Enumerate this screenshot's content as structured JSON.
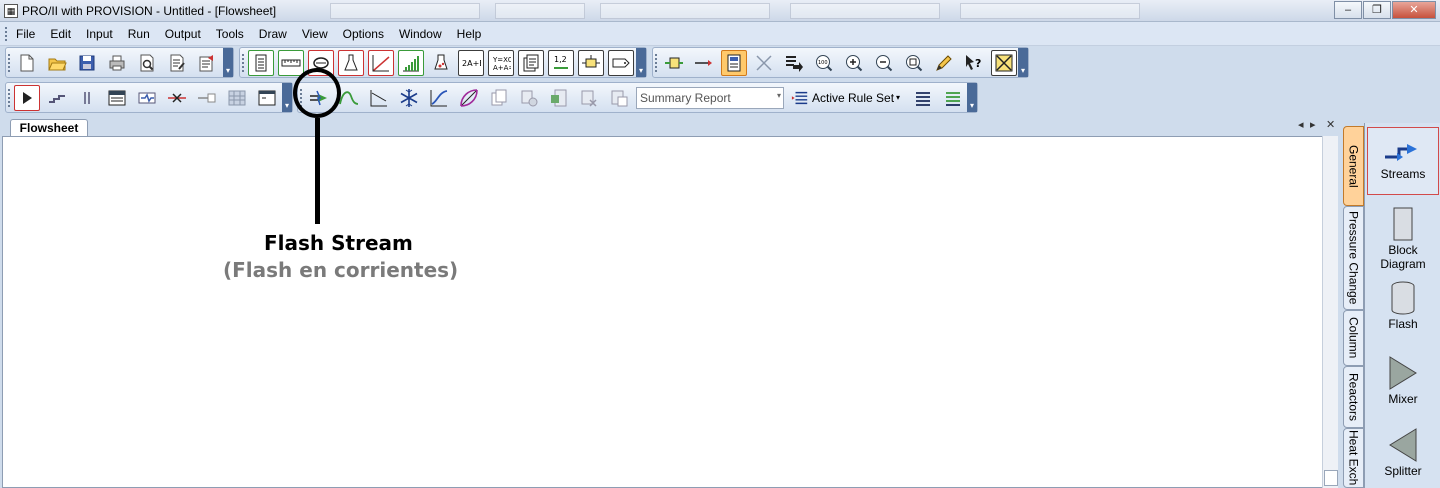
{
  "window": {
    "title": "PRO/II with PROVISION - Untitled - [Flowsheet]",
    "app_icon": "proii-app-icon",
    "controls": {
      "minimize": "–",
      "restore": "❐",
      "close": "✕"
    }
  },
  "menubar": {
    "items": [
      {
        "label": "File"
      },
      {
        "label": "Edit"
      },
      {
        "label": "Input"
      },
      {
        "label": "Run"
      },
      {
        "label": "Output"
      },
      {
        "label": "Tools"
      },
      {
        "label": "Draw"
      },
      {
        "label": "View"
      },
      {
        "label": "Options"
      },
      {
        "label": "Window"
      },
      {
        "label": "Help"
      }
    ]
  },
  "toolbar": {
    "summary_report": "Summary Report",
    "active_rule_set": "Active Rule Set",
    "dropdown_arrow": "▾",
    "overflow_glyph": "▾"
  },
  "document_tabs": {
    "active": "Flowsheet",
    "nav_left": "◂",
    "nav_right": "▸",
    "close": "✕"
  },
  "annotation": {
    "title": "Flash Stream",
    "subtitle": "(Flash en corrientes)"
  },
  "palette": {
    "tabs": [
      {
        "label": "General",
        "active": true
      },
      {
        "label": "Pressure Change"
      },
      {
        "label": "Column"
      },
      {
        "label": "Reactors"
      },
      {
        "label": "Heat Exch"
      }
    ],
    "items": [
      {
        "label": "Streams",
        "icon": "streams-icon",
        "active": true
      },
      {
        "label": "Block Diagram",
        "icon": "block-diagram-icon"
      },
      {
        "label": "Flash",
        "icon": "flash-drum-icon"
      },
      {
        "label": "Mixer",
        "icon": "mixer-icon"
      },
      {
        "label": "Splitter",
        "icon": "splitter-icon"
      }
    ]
  },
  "colors": {
    "accent": "#4a6a98",
    "active_tab": "#ffd29a",
    "palette_highlight": "#d24a4a"
  }
}
